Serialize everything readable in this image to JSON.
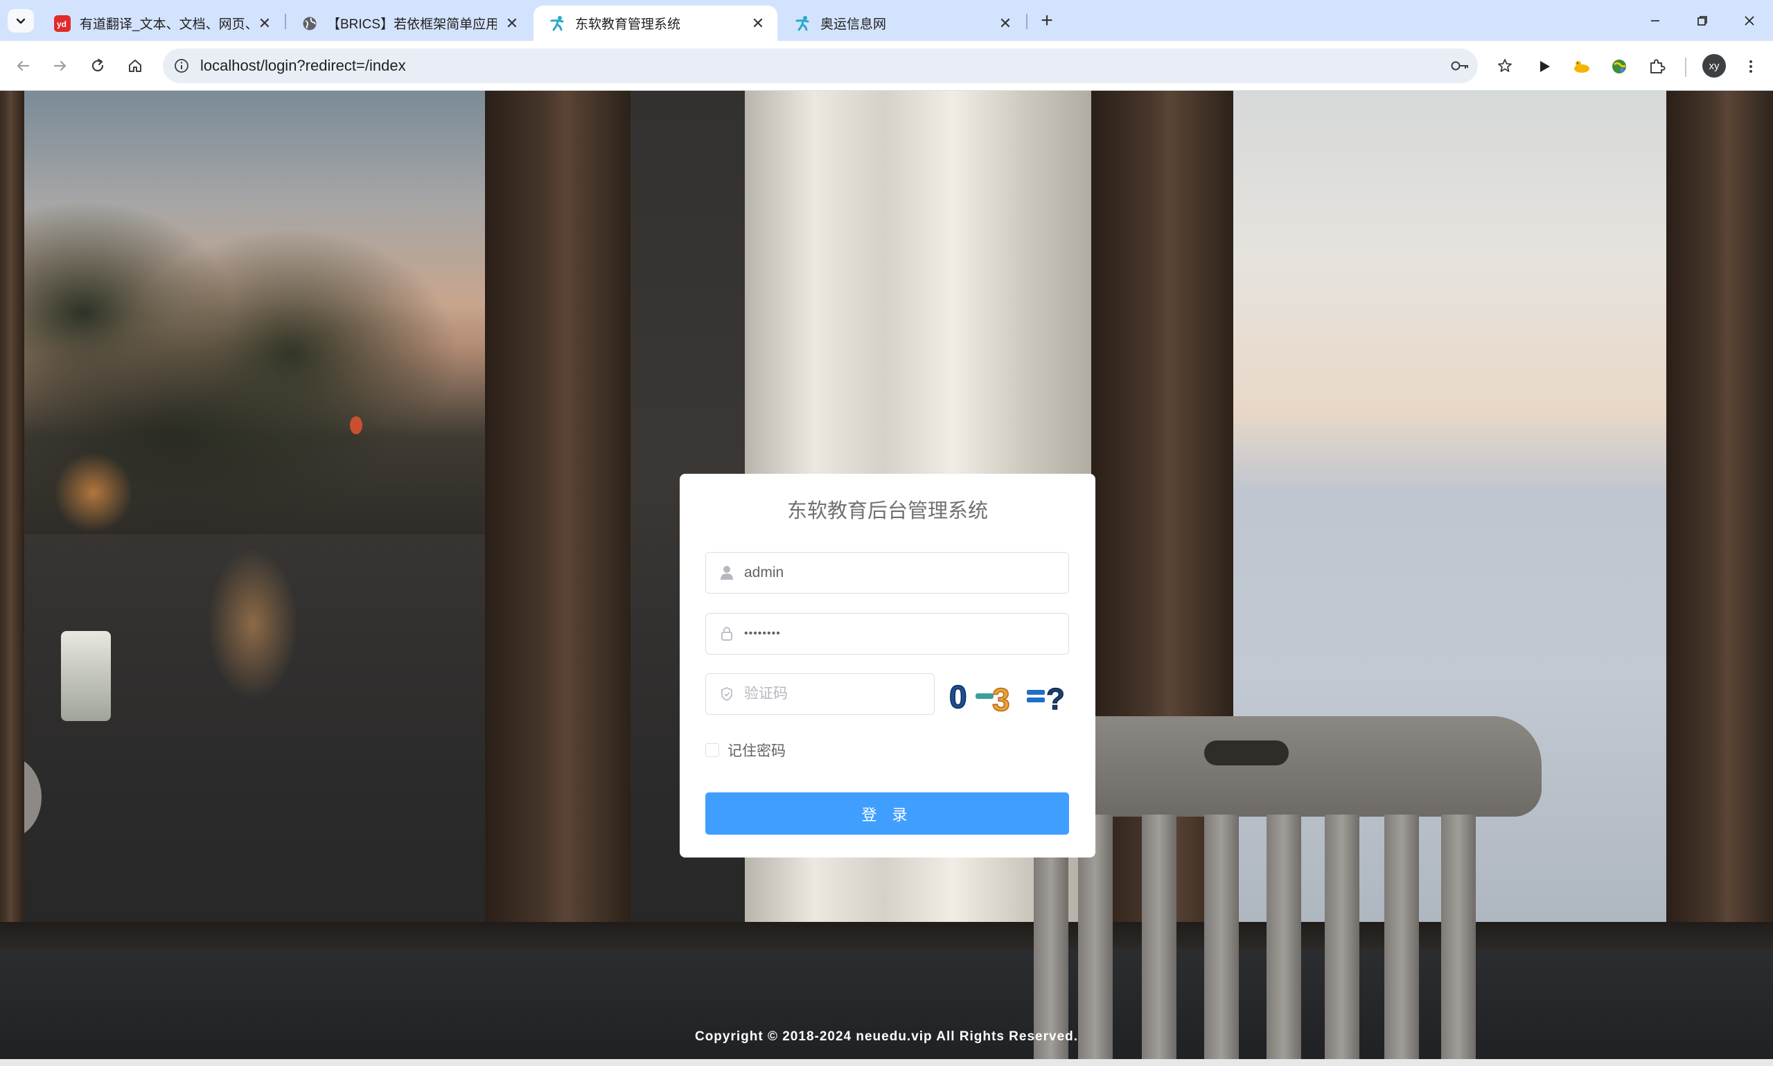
{
  "browser": {
    "tabs": [
      {
        "title": "有道翻译_文本、文档、网页、在",
        "favicon": "youdao-icon",
        "active": false
      },
      {
        "title": "【BRICS】若依框架简单应用 |",
        "favicon": "globe-icon",
        "active": false
      },
      {
        "title": "东软教育管理系统",
        "favicon": "neuedu-icon",
        "active": true
      },
      {
        "title": "奥运信息网",
        "favicon": "neuedu-icon",
        "active": false
      }
    ],
    "new_tab_label": "+",
    "url": "localhost/login?redirect=/index",
    "avatar_initials": "xy",
    "accent_color": "#d3e3fd"
  },
  "login": {
    "title": "东软教育后台管理系统",
    "username_value": "admin",
    "password_value": "••••••••",
    "captcha_placeholder": "验证码",
    "captcha_image_text": "0-3=?",
    "remember_label": "记住密码",
    "remember_checked": false,
    "submit_label": "登 录",
    "button_color": "#409eff"
  },
  "footer": {
    "copyright": "Copyright © 2018-2024 neuedu.vip All Rights Reserved."
  }
}
